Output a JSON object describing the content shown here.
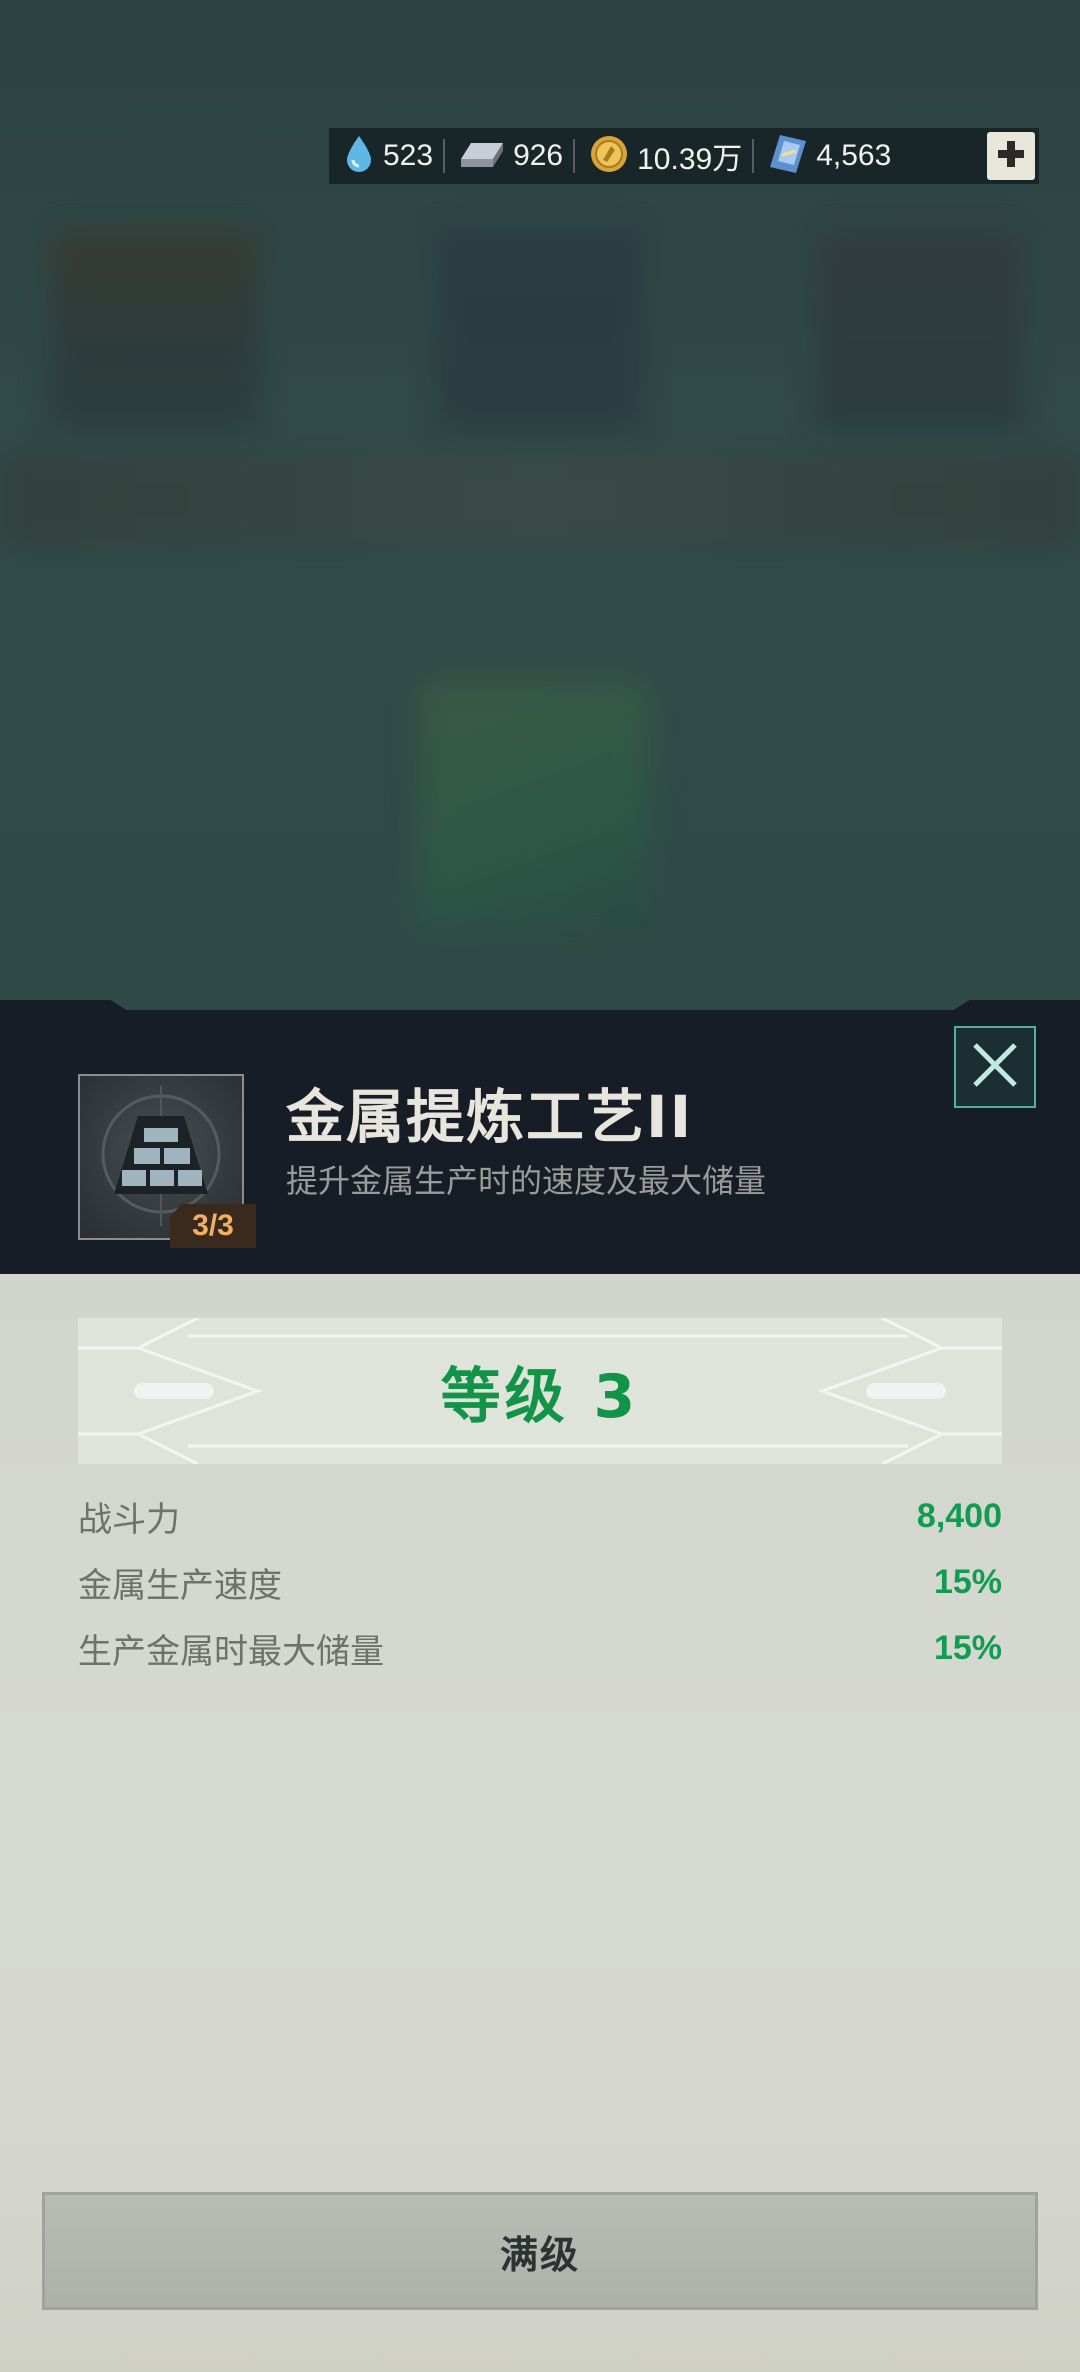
{
  "resources": [
    {
      "icon": "water-drop-icon",
      "value": "523"
    },
    {
      "icon": "metal-ingot-icon",
      "value": "926"
    },
    {
      "icon": "gold-coin-icon",
      "value": "10.39万"
    },
    {
      "icon": "blueprint-card-icon",
      "value": "4,563"
    }
  ],
  "header": {
    "title": "金属提炼工艺II",
    "description": "提升金属生产时的速度及最大储量",
    "level_badge": "3/3"
  },
  "body": {
    "level_title": "等级 3",
    "stats": [
      {
        "label": "战斗力",
        "value": "8,400"
      },
      {
        "label": "金属生产速度",
        "value": "15%"
      },
      {
        "label": "生产金属时最大储量",
        "value": "15%"
      }
    ],
    "max_button_label": "满级"
  },
  "colors": {
    "accent_green": "#129c52",
    "header_bg": "#161d27",
    "body_bg": "#d5d8d0",
    "badge_text": "#f0b060",
    "close_border": "#4fb0a6"
  }
}
